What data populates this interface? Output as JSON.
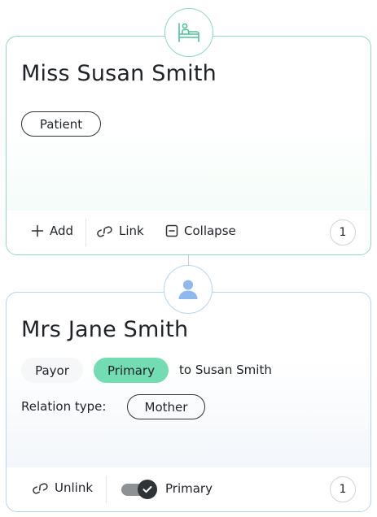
{
  "patient": {
    "name": "Miss Susan Smith",
    "role_badge": "Patient",
    "avatar_icon": "patient-bed-icon",
    "actions": {
      "add_label": "Add",
      "link_label": "Link",
      "collapse_label": "Collapse"
    },
    "count": "1"
  },
  "payor": {
    "name": "Mrs Jane Smith",
    "type_tag": "Payor",
    "primary_tag": "Primary",
    "relation_target": "to Susan Smith",
    "relation_type_label": "Relation type:",
    "relation_type_value": "Mother",
    "avatar_icon": "person-icon",
    "actions": {
      "unlink_label": "Unlink",
      "primary_toggle_label": "Primary",
      "primary_toggle_on": true
    },
    "count": "1"
  },
  "colors": {
    "patient_accent": "#74dcb3",
    "payor_accent": "#b6d6ef",
    "primary_tag_bg": "#74dcb3",
    "person_icon": "#8fb8ec"
  }
}
